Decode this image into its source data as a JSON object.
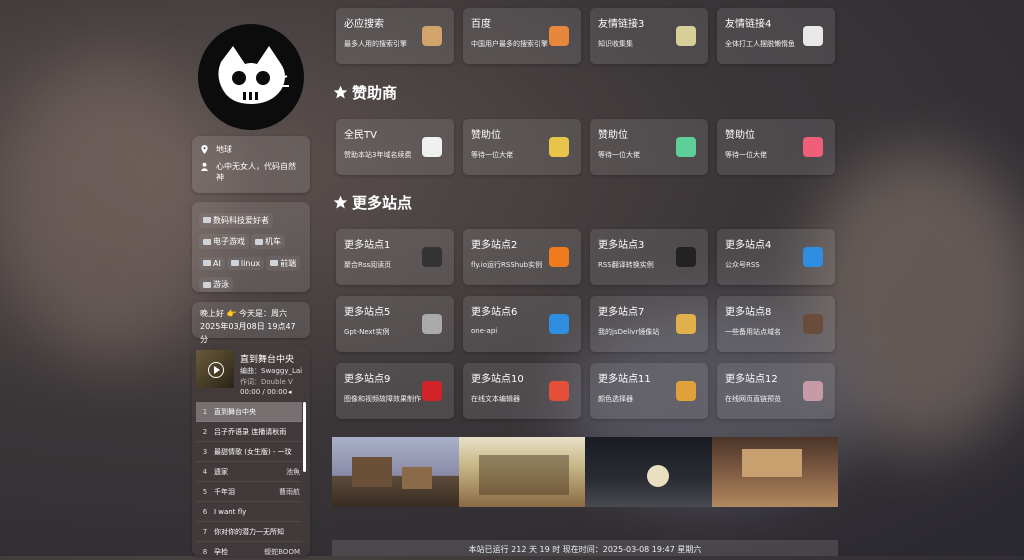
{
  "profile": {
    "location": "地球",
    "motto": "心中无女人，代码自然神"
  },
  "tags": [
    {
      "label": "数码科技爱好者",
      "icon": "laptop-icon"
    },
    {
      "label": "电子游戏",
      "icon": "gamepad-icon"
    },
    {
      "label": "机车",
      "icon": "motorcycle-icon"
    },
    {
      "label": "AI",
      "icon": "robot-icon"
    },
    {
      "label": "linux",
      "icon": "terminal-icon"
    },
    {
      "label": "前端",
      "icon": "keyboard-icon"
    },
    {
      "label": "游泳",
      "icon": "swim-icon"
    }
  ],
  "greeting": {
    "line1": "晚上好 👉 今天是：周六",
    "line2": "2025年03月08日 19点47分"
  },
  "player": {
    "title": "直到舞台中央",
    "arranger": "编曲：Swaggy_Lai",
    "composer": "作词：Double V",
    "time": "00:00 / 00:00",
    "playlist": [
      {
        "num": "1",
        "name": "直到舞台中央",
        "artist": ""
      },
      {
        "num": "2",
        "name": "吕子乔语录 连播请秋雨",
        "artist": ""
      },
      {
        "num": "3",
        "name": "最甜情歌 (女生版) - 一玟",
        "artist": ""
      },
      {
        "num": "4",
        "name": "遗家",
        "artist": "池魚"
      },
      {
        "num": "5",
        "name": "千年泪",
        "artist": "曹雨航"
      },
      {
        "num": "6",
        "name": "I want fly",
        "artist": ""
      },
      {
        "num": "7",
        "name": "你对你的潜力一无所知",
        "artist": ""
      },
      {
        "num": "8",
        "name": "孕检",
        "artist": "蝮蛇BOOM"
      }
    ]
  },
  "search_sites": [
    {
      "name": "必应搜索",
      "desc": "最多人用的搜索引擎",
      "icon": "box-icon",
      "color": "#d2a36a"
    },
    {
      "name": "百度",
      "desc": "中国用户最多的搜索引擎",
      "icon": "magnifier-icon",
      "color": "#e7873b"
    },
    {
      "name": "友情链接3",
      "desc": "知识收集集",
      "icon": "mushroom-icon",
      "color": "#d8cf98"
    },
    {
      "name": "友情链接4",
      "desc": "全体打工人摆脱懒惰鱼",
      "icon": "panda-icon",
      "color": "#e8e8e8"
    }
  ],
  "sponsor_title": "赞助商",
  "sponsors": [
    {
      "name": "全民TV",
      "desc": "赞助本站3年域名续费",
      "icon": "ghost-icon",
      "color": "#f0f0f0"
    },
    {
      "name": "赞助位",
      "desc": "等待一位大佬",
      "icon": "pacman-ghost-icon",
      "color": "#e6c54a"
    },
    {
      "name": "赞助位",
      "desc": "等待一位大佬",
      "icon": "alien-icon",
      "color": "#5fcf9a"
    },
    {
      "name": "赞助位",
      "desc": "等待一位大佬",
      "icon": "ribbon-icon",
      "color": "#ef5f7a"
    }
  ],
  "more_title": "更多站点",
  "more_sites": [
    {
      "name": "更多站点1",
      "desc": "聚合Rss阅读页",
      "icon": "penguin-icon",
      "color": "#333"
    },
    {
      "name": "更多站点2",
      "desc": "fly.io运行RSShub实例",
      "icon": "rss-icon",
      "color": "#f07b1c"
    },
    {
      "name": "更多站点3",
      "desc": "RSS翻译转换实例",
      "icon": "penguin-icon",
      "color": "#222"
    },
    {
      "name": "更多站点4",
      "desc": "公众号RSS",
      "icon": "doraemon-icon",
      "color": "#2f8ee0"
    },
    {
      "name": "更多站点5",
      "desc": "Gpt-Next实例",
      "icon": "satellite-icon",
      "color": "#aaa"
    },
    {
      "name": "更多站点6",
      "desc": "one-api",
      "icon": "doraemon-icon",
      "color": "#2f8ee0"
    },
    {
      "name": "更多站点7",
      "desc": "我的jsDelivr镜像站",
      "icon": "folder-icon",
      "color": "#e1b04c"
    },
    {
      "name": "更多站点8",
      "desc": "一些备用站点域名",
      "icon": "character-icon",
      "color": "#6a4c3a"
    },
    {
      "name": "更多站点9",
      "desc": "图像和视频故障效果制作",
      "icon": "sharingan-icon",
      "color": "#d0242a"
    },
    {
      "name": "更多站点10",
      "desc": "在线文本编辑器",
      "icon": "notepad-icon",
      "color": "#e44f3a"
    },
    {
      "name": "更多站点11",
      "desc": "颜色选择器",
      "icon": "pineapple-icon",
      "color": "#e0a03a"
    },
    {
      "name": "更多站点12",
      "desc": "在线网页直链预览",
      "icon": "ufo-icon",
      "color": "#c69aa6"
    }
  ],
  "footer": "本站已运行 212 天 19 时 现在时间：2025-03-08 19:47 星期六"
}
